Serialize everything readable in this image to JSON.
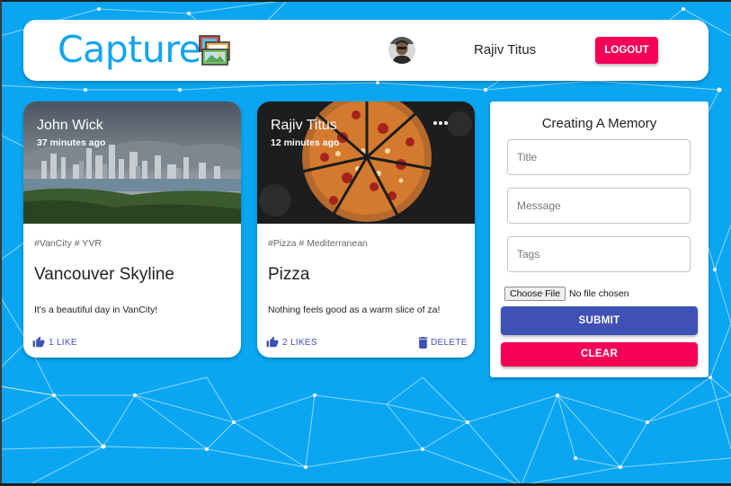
{
  "header": {
    "brand": "Capture",
    "brand_icon": "photo-gallery-icon",
    "user_name": "Rajiv Titus",
    "logout_label": "LOGOUT"
  },
  "posts": [
    {
      "author": "John Wick",
      "time": "37 minutes ago",
      "tags": "#VanCity # YVR",
      "title": "Vancouver Skyline",
      "message": "It's a beautiful day in VanCity!",
      "likes_label": "1 LIKE"
    },
    {
      "author": "Rajiv Titus",
      "time": "12 minutes ago",
      "tags": "#Pizza # Mediterranean",
      "title": "Pizza",
      "message": "Nothing feels good as a warm slice of za!",
      "likes_label": "2 LIKES",
      "delete_label": "DELETE"
    }
  ],
  "form": {
    "heading": "Creating A Memory",
    "title_placeholder": "Title",
    "message_placeholder": "Message",
    "tags_placeholder": "Tags",
    "file_button": "Choose File",
    "file_status": "No file chosen",
    "submit_label": "SUBMIT",
    "clear_label": "CLEAR"
  },
  "colors": {
    "background": "#0aa6f2",
    "brand": "#13a4ef",
    "primary": "#3f51b5",
    "secondary": "#f50057"
  }
}
